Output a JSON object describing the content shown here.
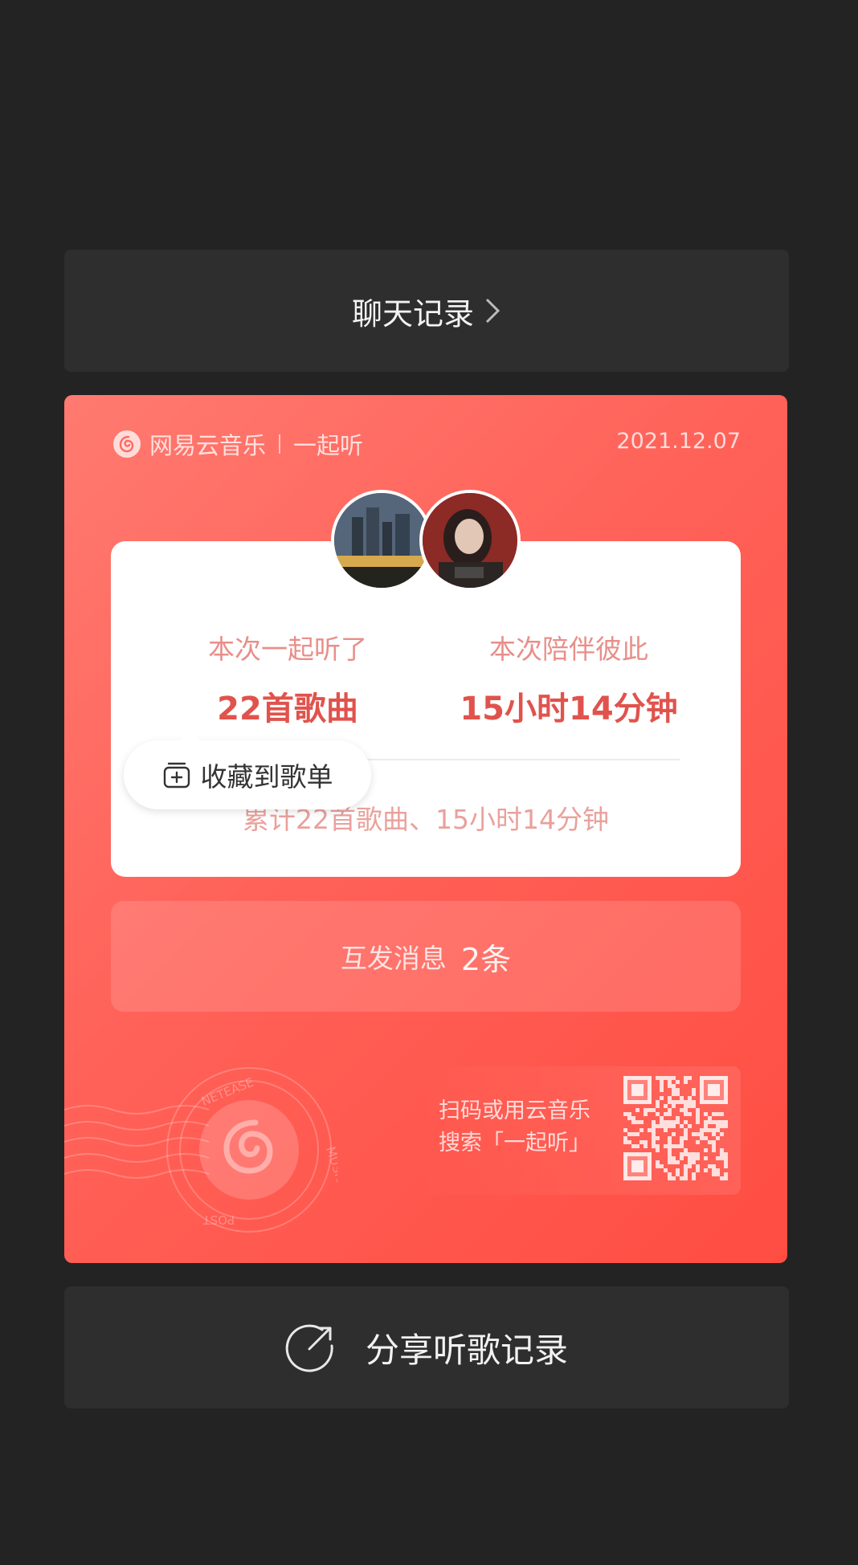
{
  "chat_record": {
    "label": "聊天记录"
  },
  "card": {
    "brand": "网易云音乐",
    "brand_sub": "一起听",
    "date": "2021.12.07",
    "stats": {
      "left_label": "本次一起听了",
      "left_value": "22首歌曲",
      "right_label": "本次陪伴彼此",
      "right_value": "15小时14分钟"
    },
    "save_tip": "收藏到歌单",
    "cumulative": "累计22首歌曲、15小时14分钟",
    "messages": {
      "label": "互发消息",
      "count": "2条"
    },
    "stamp": {
      "top_text": "NETEASE",
      "right_text": "MUSIC LYRICS",
      "bottom_text": "POST"
    },
    "qr": {
      "line1": "扫码或用云音乐",
      "line2": "搜索「一起听」"
    },
    "colors": {
      "card_top": "#ff7a70",
      "card_bottom": "#ff4d42",
      "accent": "#e0534c"
    }
  },
  "share": {
    "label": "分享听歌记录"
  },
  "icons": [
    "chevron-right-icon",
    "netease-logo-icon",
    "add-to-playlist-icon",
    "netease-stamp-icon",
    "qr-code",
    "share-icon"
  ]
}
